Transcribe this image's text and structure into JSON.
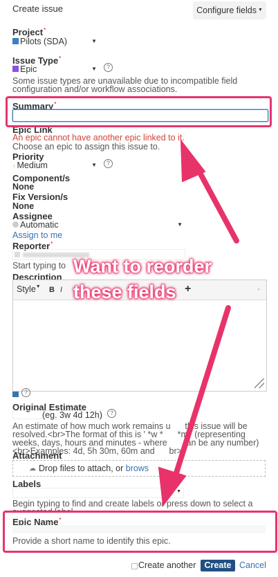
{
  "header": {
    "title": "Create issue",
    "configure_label": "Configure fields"
  },
  "project": {
    "label": "Project",
    "value": "Pilots (SDA)"
  },
  "issue_type": {
    "label": "Issue Type",
    "value": "Epic",
    "note_line1": "Some issue types are unavailable due to incompatible field",
    "note_line2": "configuration and/or workflow associations."
  },
  "summary": {
    "label": "Summary",
    "value": ""
  },
  "epic_link": {
    "label": "Epic Link",
    "error": "An epic cannot have another epic linked to it.",
    "help": "Choose an epic to assign this issue to."
  },
  "priority": {
    "label": "Priority",
    "value": "Medium"
  },
  "components": {
    "label": "Component/s",
    "value": "None"
  },
  "fix_version": {
    "label": "Fix Version/s",
    "value": "None"
  },
  "assignee": {
    "label": "Assignee",
    "value": "Automatic",
    "assign_to_me": "Assign to me"
  },
  "reporter": {
    "label": "Reporter",
    "hint": "Start typing to"
  },
  "description": {
    "label": "Description",
    "style_label": "Style",
    "bold": "B",
    "italic": "I",
    "plus": "+",
    "minus": "-"
  },
  "original_estimate": {
    "label": "Original Estimate",
    "placeholder": "(eg. 3w 4d 12h)",
    "help_line1": "An estimate of how much work remains u      this issue will be",
    "help_line2": "resolved.<br>The format of this is ' *w *      *m ' (representing",
    "help_line3": "weeks, days, hours and minutes - where        an be any number)",
    "help_line4": "<br>Examples: 4d, 5h 30m, 60m and      br>"
  },
  "attachment": {
    "label": "Attachment",
    "drop_text": "Drop files to attach, or",
    "browse": "brows"
  },
  "labels": {
    "label": "Labels",
    "help_line1": "Begin typing to find and create labels or press down to select a",
    "help_line2": "suggested label."
  },
  "epic_name": {
    "label": "Epic Name",
    "help": "Provide a short name to identify this epic."
  },
  "footer": {
    "create_another": "Create another",
    "create_button": "Create",
    "cancel": "Cancel"
  },
  "annotation": {
    "line1": "Want to reorder",
    "line2": "these fields"
  },
  "colors": {
    "highlight": "#e8336a",
    "error": "#d04437",
    "link": "#3572b0",
    "primary": "#205081"
  }
}
